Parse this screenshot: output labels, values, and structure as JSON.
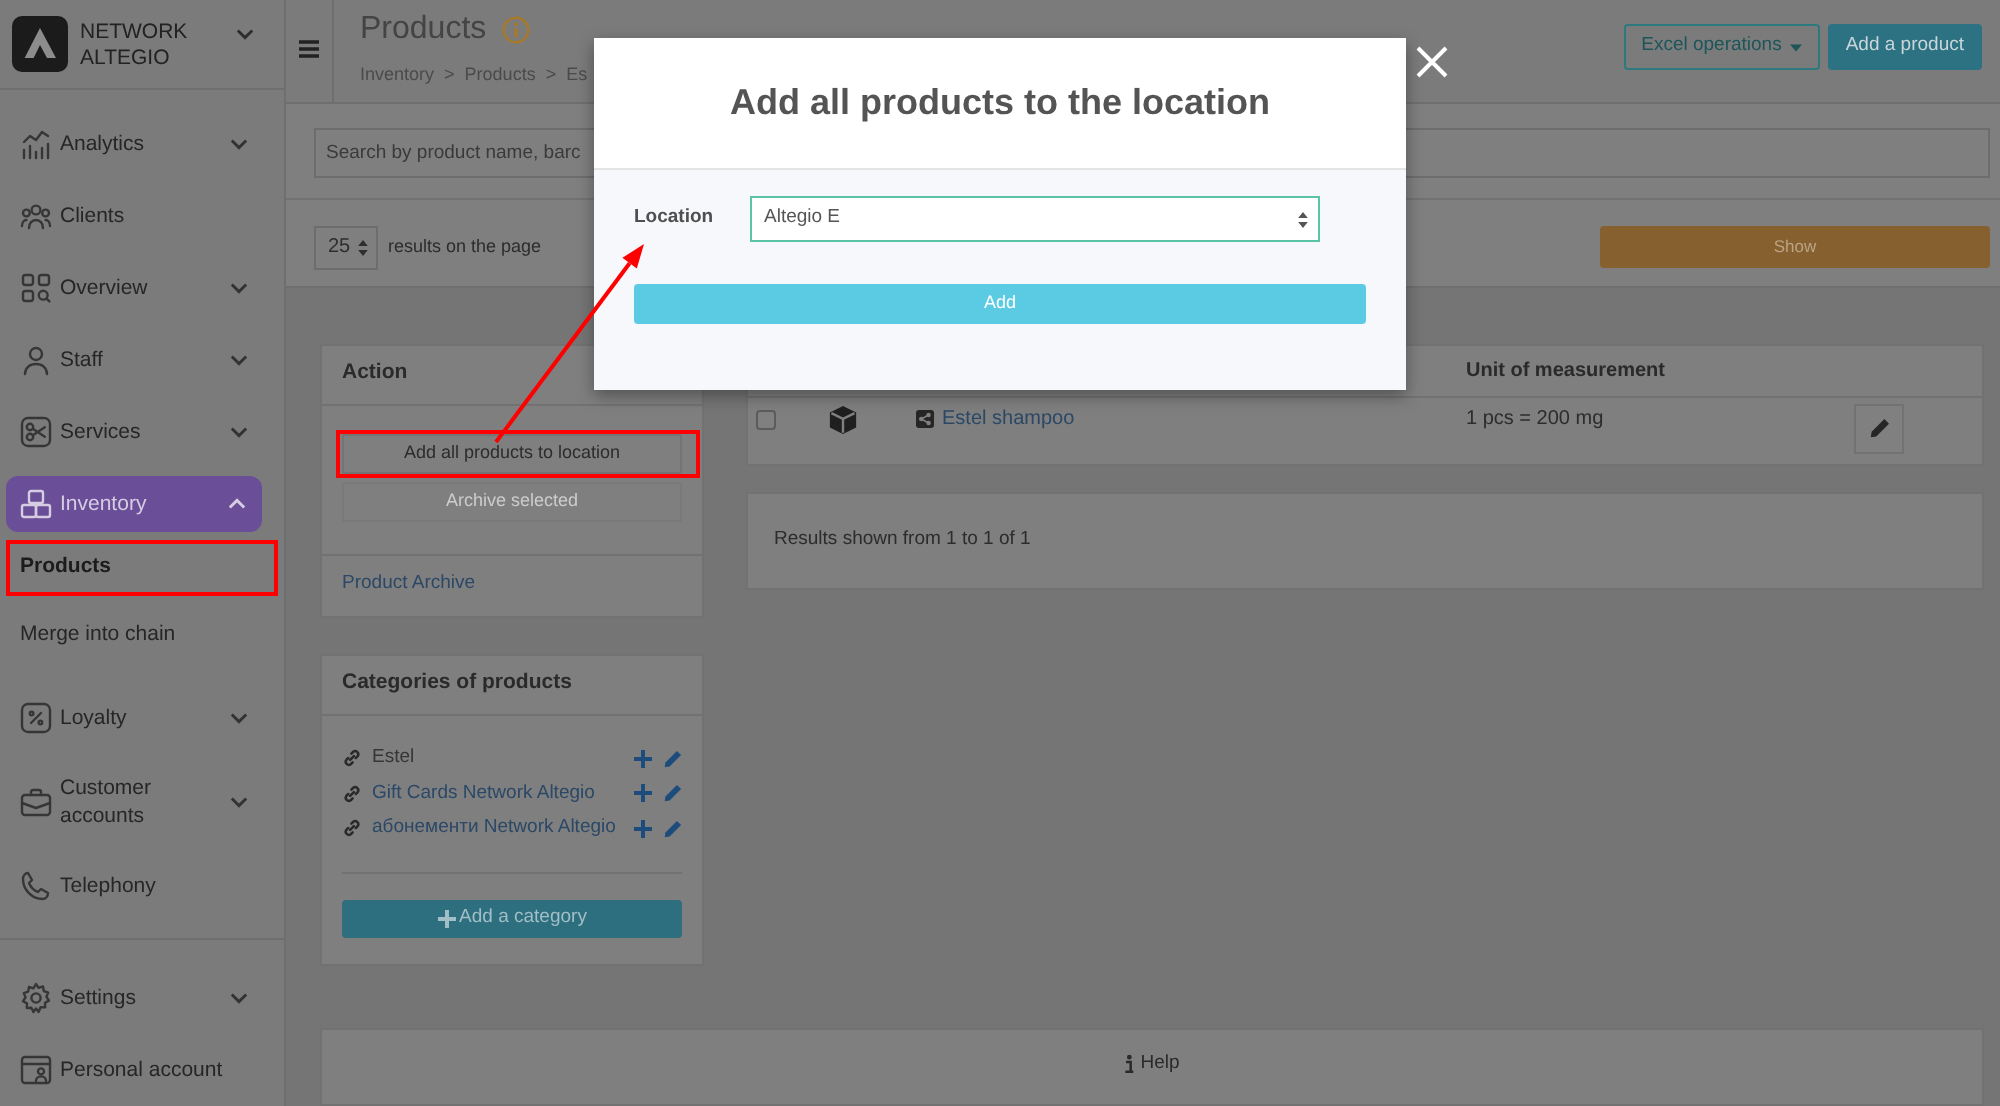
{
  "sidebar": {
    "brand": "NETWORK ALTEGIO",
    "items": [
      {
        "label": "Analytics",
        "kind": "menu",
        "expanded": false,
        "selected": false
      },
      {
        "label": "Clients",
        "kind": "link",
        "selected": false
      },
      {
        "label": "Overview",
        "kind": "menu",
        "expanded": false,
        "selected": false
      },
      {
        "label": "Staff",
        "kind": "menu",
        "expanded": false,
        "selected": false
      },
      {
        "label": "Services",
        "kind": "menu",
        "expanded": false,
        "selected": false
      },
      {
        "label": "Inventory",
        "kind": "menu",
        "expanded": true,
        "selected": true,
        "children": [
          {
            "label": "Products",
            "selected": true,
            "highlighted": true
          },
          {
            "label": "Merge into chain",
            "selected": false,
            "highlighted": false
          }
        ]
      },
      {
        "label": "Loyalty",
        "kind": "menu",
        "expanded": false,
        "selected": false
      },
      {
        "label": "Customer accounts",
        "kind": "menu",
        "expanded": false,
        "selected": false
      },
      {
        "label": "Telephony",
        "kind": "link",
        "selected": false
      }
    ],
    "footer_items": [
      {
        "label": "Settings",
        "kind": "menu",
        "expanded": false,
        "selected": false
      },
      {
        "label": "Personal account",
        "kind": "link",
        "selected": false
      }
    ]
  },
  "header": {
    "title": "Products",
    "breadcrumbs": {
      "separator": ">",
      "items": [
        "Inventory",
        "Products",
        "Es"
      ]
    },
    "buttons": [
      {
        "label": "Excel operations",
        "kind": "dropdown"
      },
      {
        "label": "Add a product",
        "kind": "primary"
      }
    ]
  },
  "filters": {
    "search": {
      "placeholder": "Search by product name, barc"
    },
    "page_size": "25",
    "page_size_label": "results on the page",
    "show_button": "Show"
  },
  "actions": {
    "title": "Action",
    "buttons": [
      {
        "label": "Add all products to location",
        "disabled": false,
        "highlighted": true
      },
      {
        "label": "Archive selected",
        "disabled": true,
        "highlighted": false
      }
    ],
    "archive_link": "Product Archive"
  },
  "categories": {
    "title": "Categories of products",
    "items": [
      {
        "label": "Estel",
        "selected": true
      },
      {
        "label": "Gift Cards Network Altegio",
        "selected": false
      },
      {
        "label": "абонементи Network Altegio",
        "selected": false
      }
    ],
    "add_button": "Add a category"
  },
  "table": {
    "unit_header": "Unit of measurement",
    "rows": [
      {
        "checked": false,
        "name": "Estel shampoo",
        "unit": "1 pcs = 200 mg"
      }
    ]
  },
  "results": "Results shown from 1 to 1 of 1",
  "help": "Help",
  "dialog": {
    "title": "Add all products to the location",
    "fields": [
      {
        "label": "Location",
        "value": "Altegio E"
      }
    ],
    "submit": "Add"
  }
}
